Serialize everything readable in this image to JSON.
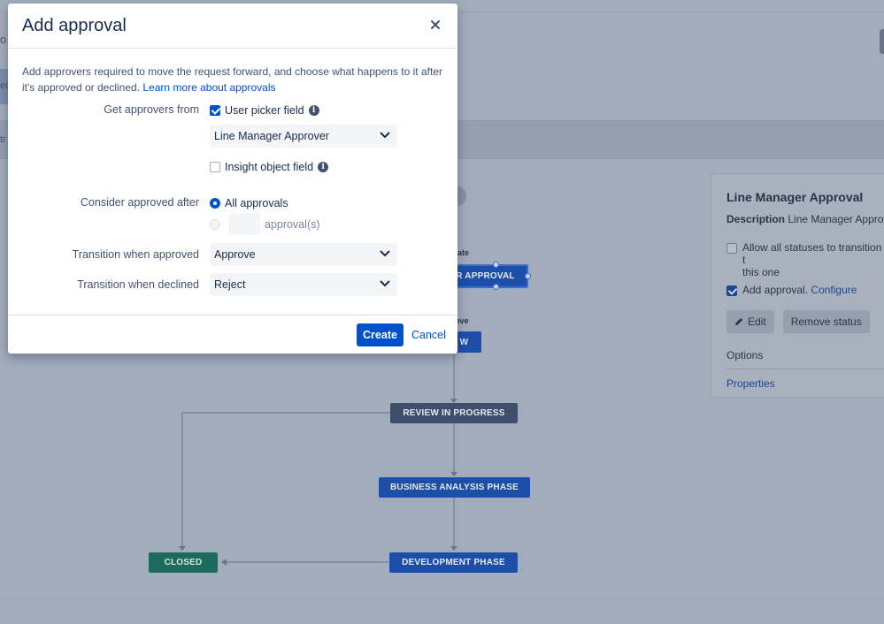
{
  "modal": {
    "title": "Add approval",
    "intro_text": "Add approvers required to move the request forward, and choose what happens to it after it's approved or declined.",
    "learn_more_link": "Learn more about approvals",
    "get_approvers_label": "Get approvers from",
    "user_picker_label": "User picker field",
    "user_picker_checked": true,
    "user_picker_select_value": "Line Manager Approver",
    "insight_label": "Insight object field",
    "insight_checked": false,
    "consider_label": "Consider approved after",
    "all_approvals_label": "All approvals",
    "approvals_count_suffix": "approval(s)",
    "approvals_count_value": "",
    "approved_label": "Transition when approved",
    "approved_value": "Approve",
    "declined_label": "Transition when declined",
    "declined_value": "Reject",
    "create_label": "Create",
    "cancel_label": "Cancel"
  },
  "background": {
    "left_letters": [
      "o",
      "ec",
      "tr"
    ],
    "transition_label_top": "ate",
    "transition_label_mid": "ove",
    "nodes": {
      "approval": "R APPROVAL",
      "partial": "W",
      "review": "REVIEW IN PROGRESS",
      "business": "BUSINESS ANALYSIS PHASE",
      "development": "DEVELOPMENT PHASE",
      "closed": "CLOSED"
    }
  },
  "side_panel": {
    "title": "Line Manager Approval",
    "desc_label": "Description",
    "desc_value": "Line Manager Approv",
    "allow_statuses": "Allow all statuses to transition t",
    "allow_statuses_2": "this one",
    "add_approval": "Add approval.",
    "configure": "Configure",
    "edit": "Edit",
    "remove_status": "Remove status",
    "options": "Options",
    "properties": "Properties"
  }
}
